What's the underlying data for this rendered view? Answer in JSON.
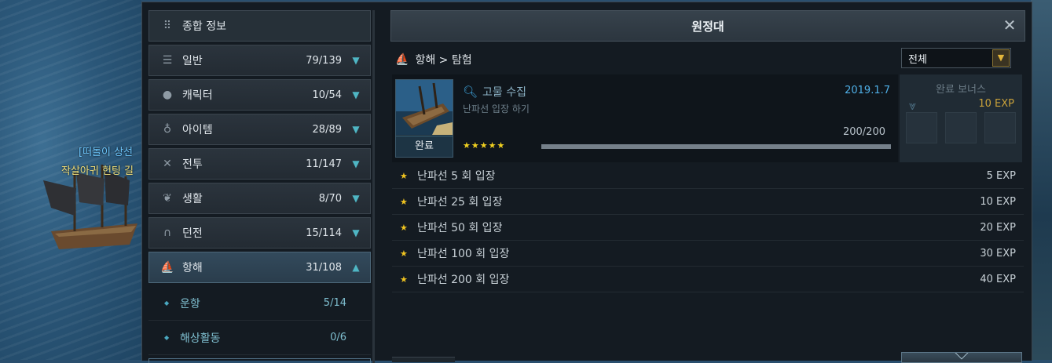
{
  "scene": {
    "npc_name": "[떠돌이 상선",
    "npc_guild": "작살아귀 헌팅 길"
  },
  "window": {
    "title": "원정대",
    "close_icon": "close-icon"
  },
  "nav": {
    "top_item": {
      "label": "종합 정보",
      "icon": "grid-icon"
    },
    "items": [
      {
        "label": "일반",
        "count": "79/139",
        "icon": "list-icon",
        "expanded": false
      },
      {
        "label": "캐릭터",
        "count": "10/54",
        "icon": "person-icon",
        "expanded": false
      },
      {
        "label": "아이템",
        "count": "28/89",
        "icon": "potion-icon",
        "expanded": false
      },
      {
        "label": "전투",
        "count": "11/147",
        "icon": "crossed-swords-icon",
        "expanded": false
      },
      {
        "label": "생활",
        "count": "8/70",
        "icon": "leaf-icon",
        "expanded": false
      },
      {
        "label": "던전",
        "count": "15/114",
        "icon": "gate-icon",
        "expanded": false
      },
      {
        "label": "항해",
        "count": "31/108",
        "icon": "ship-icon",
        "expanded": true
      }
    ],
    "sub_items": [
      {
        "label": "운항",
        "count": "5/14"
      },
      {
        "label": "해상활동",
        "count": "0/6"
      }
    ]
  },
  "breadcrumb": {
    "text": "항해 > 탐험",
    "icon": "ship-icon"
  },
  "filter": {
    "value": "전체"
  },
  "achievement": {
    "title": "고물 수집",
    "description": "난파선 입장 하기",
    "date": "2019.1.7",
    "progress_text": "200/200",
    "progress": 1.0,
    "stars": "★★★★★",
    "status_label": "완료"
  },
  "bonus": {
    "title": "완료 보너스",
    "exp": "10 EXP"
  },
  "rewards": [
    {
      "label": "난파선 5 회 입장",
      "exp": "5 EXP"
    },
    {
      "label": "난파선 25 회 입장",
      "exp": "10 EXP"
    },
    {
      "label": "난파선 50 회 입장",
      "exp": "20 EXP"
    },
    {
      "label": "난파선 100 회 입장",
      "exp": "30 EXP"
    },
    {
      "label": "난파선 200 회 입장",
      "exp": "40 EXP"
    }
  ],
  "colors": {
    "accent_teal": "#4fb6c4",
    "date_blue": "#4fb0e8",
    "star_gold": "#f0c420",
    "exp_gold": "#c9a13a"
  }
}
